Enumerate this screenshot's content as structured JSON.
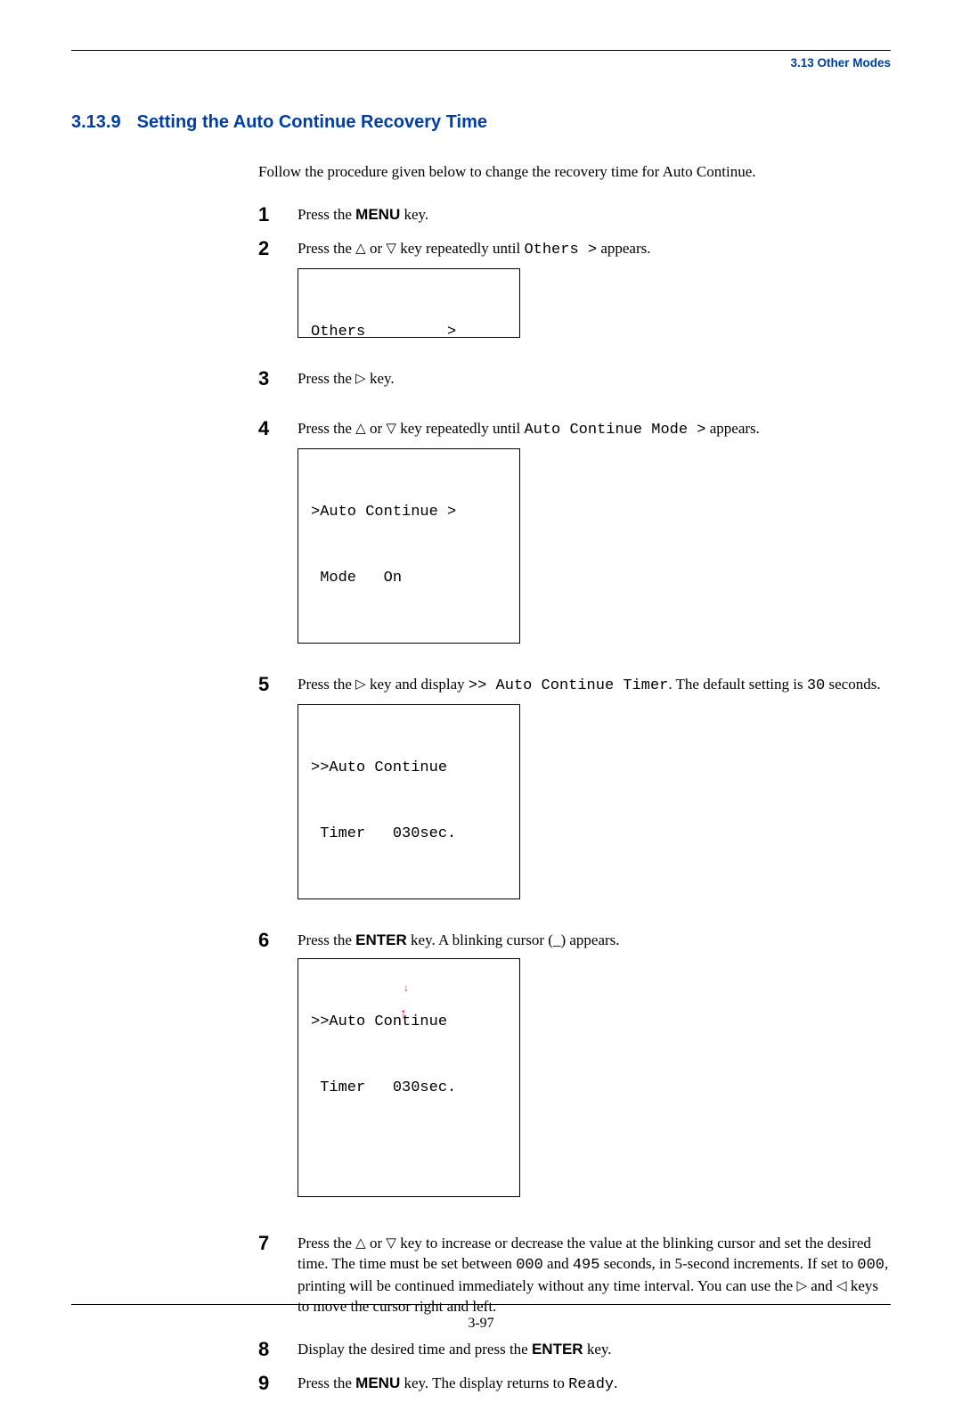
{
  "header": {
    "breadcrumb": "3.13 Other Modes"
  },
  "section": {
    "number": "3.13.9",
    "title": "Setting the Auto Continue Recovery Time"
  },
  "intro": "Follow the procedure given below to change the recovery time for Auto Continue.",
  "glyph": {
    "up": "△",
    "down": "▽",
    "right": "▷",
    "left": "◁"
  },
  "steps": {
    "s1": {
      "num": "1",
      "a": "Press the ",
      "key": "MENU",
      "b": " key."
    },
    "s2": {
      "num": "2",
      "a": "Press the ",
      "b": " or ",
      "c": " key repeatedly until ",
      "code": "Others >",
      "d": " appears.",
      "lcd_l1": "Others         >",
      "lcd_l2": " "
    },
    "s3": {
      "num": "3",
      "a": "Press the ",
      "b": " key."
    },
    "s4": {
      "num": "4",
      "a": "Press the ",
      "b": " or ",
      "c": " key repeatedly until ",
      "code": "Auto Continue Mode >",
      "d": " appears.",
      "lcd_l1": ">Auto Continue >",
      "lcd_l2": " Mode   On"
    },
    "s5": {
      "num": "5",
      "a": "Press the ",
      "b": " key and display ",
      "code": ">> Auto Continue Timer",
      "c": ". The default setting is ",
      "code2": "30",
      "d": " seconds.",
      "lcd_l1": ">>Auto Continue",
      "lcd_l2": " Timer   030sec."
    },
    "s6": {
      "num": "6",
      "a": "Press the ",
      "key": "ENTER",
      "b": " key. A blinking cursor (_) appears.",
      "lcd_l1": ">>Auto Continue",
      "lcd_l2": " Timer   030sec."
    },
    "s7": {
      "num": "7",
      "a": "Press the ",
      "b": " or ",
      "c": " key to increase or decrease the value at the blinking cursor and set the desired time. The time must be set between ",
      "code1": "000",
      "d": " and ",
      "code2": "495",
      "e": " seconds, in 5-second increments. If set to ",
      "code3": "000",
      "f": ", printing will be continued immediately without any time interval. You can use the ",
      "g": " and ",
      "h": " keys to move the cursor right and left."
    },
    "s8": {
      "num": "8",
      "a": "Display the desired time and press the ",
      "key": "ENTER",
      "b": " key."
    },
    "s9": {
      "num": "9",
      "a": "Press the ",
      "key": "MENU",
      "b": " key. The display returns to ",
      "code": "Ready",
      "c": "."
    }
  },
  "footer": {
    "page": "3-97"
  }
}
